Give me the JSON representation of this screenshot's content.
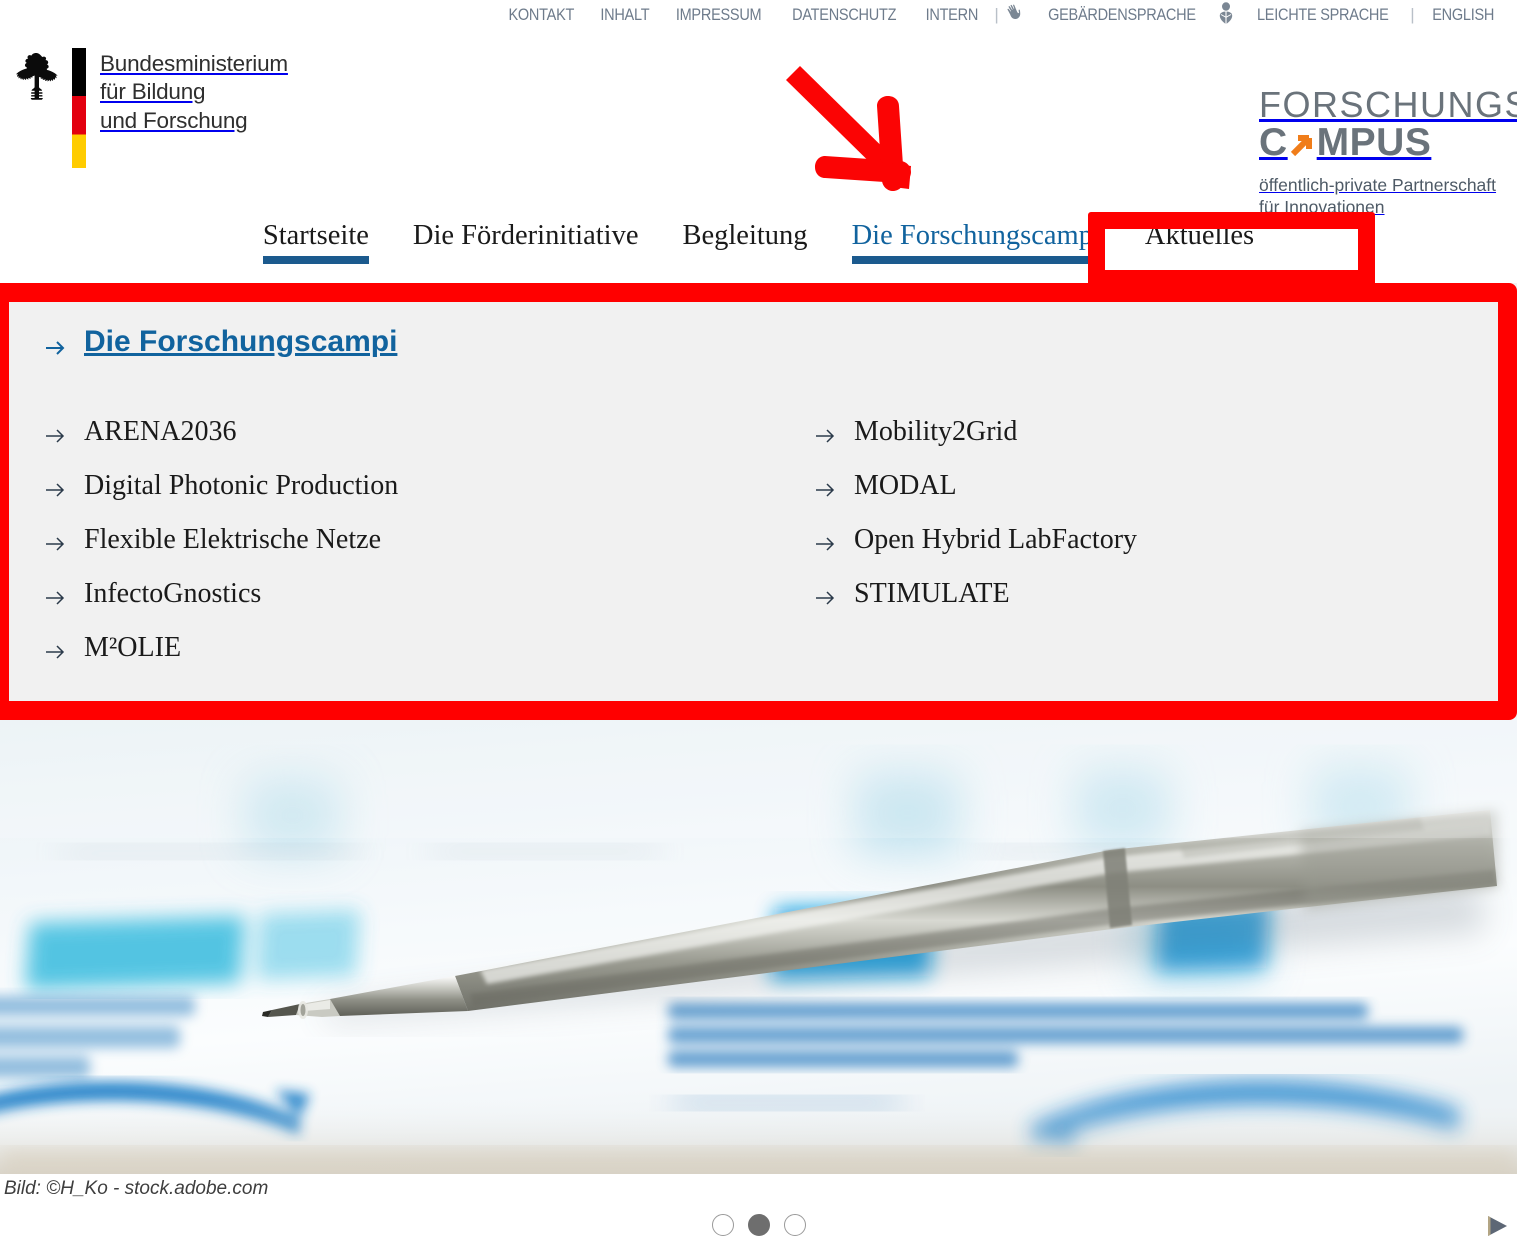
{
  "meta_nav": {
    "items": [
      {
        "label": "KONTAKT",
        "icon": null
      },
      {
        "label": "INHALT",
        "icon": null
      },
      {
        "label": "IMPRESSUM",
        "icon": null
      },
      {
        "label": "DATENSCHUTZ",
        "icon": null
      },
      {
        "label": "INTERN",
        "icon": null
      },
      {
        "label": "GEBÄRDENSPRACHE",
        "icon": "sign-language-icon"
      },
      {
        "label": "LEICHTE SPRACHE",
        "icon": "easy-language-icon"
      },
      {
        "label": "ENGLISH",
        "icon": null
      }
    ],
    "separator": "|"
  },
  "ministry_logo": {
    "line1": "Bundesministerium",
    "line2": "für Bildung",
    "line3": "und Forschung",
    "flag_colors": [
      "#000000",
      "#e3000f",
      "#ffcc00"
    ],
    "emblem": "federal-eagle-icon"
  },
  "campus_logo": {
    "line1": "FORSCHUNGS",
    "line2_pre": "C",
    "line2_post": "MPUS",
    "arrow_icon": "orange-diagonal-arrow-icon",
    "arrow_color": "#f07d1a",
    "text_color": "#6a737b",
    "subline1": "öffentlich-private Partnerschaft",
    "subline2": "für Innovationen"
  },
  "main_nav": {
    "active_index": 3,
    "active_color": "#11639e",
    "underline_color": "#1b5a8e",
    "items": [
      {
        "label": "Startseite",
        "underlined": true
      },
      {
        "label": "Die Förderinitiative",
        "underlined": false
      },
      {
        "label": "Begleitung",
        "underlined": false
      },
      {
        "label": "Die Forschungscampi",
        "underlined": true
      },
      {
        "label": "Aktuelles",
        "underlined": false
      }
    ]
  },
  "dropdown": {
    "background": "#f1f1f1",
    "heading": "Die Forschungscampi",
    "heading_color": "#11639e",
    "left_column": [
      {
        "label": "ARENA2036"
      },
      {
        "label": "Digital Photonic Production"
      },
      {
        "label": "Flexible Elektrische Netze"
      },
      {
        "label": "InfectoGnostics"
      },
      {
        "label": "M²OLIE"
      }
    ],
    "right_column": [
      {
        "label": "Mobility2Grid"
      },
      {
        "label": "MODAL"
      },
      {
        "label": "Open Hybrid LabFactory"
      },
      {
        "label": "STIMULATE"
      }
    ]
  },
  "hero": {
    "alt": "Blurred photo of a ballpoint pen lying on a printed business report with blue bar chart",
    "blurred_text_line1": "Marketing & Services Distribution",
    "blurred_text_line2": "product sales by geographic",
    "blurred_text_line3": "area in 2016",
    "caption": "Bild: ©H_Ko - stock.adobe.com"
  },
  "carousel": {
    "slide_count": 3,
    "active_slide": 2,
    "play_button": "play-icon"
  },
  "annotations": {
    "color": "#ff0000",
    "arrow": "red-annotation-arrow",
    "box_tab": "red-highlight-box-tab",
    "box_dropdown": "red-highlight-box-dropdown"
  }
}
